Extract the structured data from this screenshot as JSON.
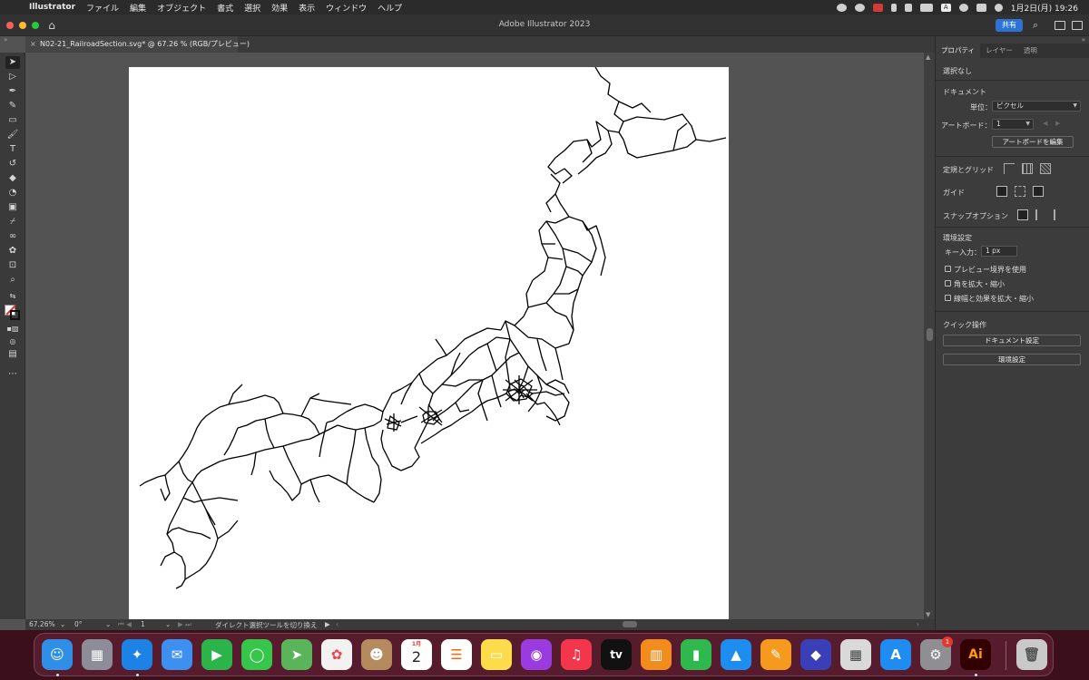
{
  "menubar": {
    "app_name": "Illustrator",
    "menus": [
      "ファイル",
      "編集",
      "オブジェクト",
      "書式",
      "選択",
      "効果",
      "表示",
      "ウィンドウ",
      "ヘルプ"
    ],
    "clock": "1月2日(月)  19:26"
  },
  "titlebar": {
    "title": "Adobe Illustrator 2023",
    "share_label": "共有"
  },
  "document_tab": {
    "label": "N02-21_RailroadSection.svg* @ 67.26 % (RGB/プレビュー)"
  },
  "statusbar": {
    "zoom": "67.26%",
    "rotation": "0°",
    "artboard_number": "1",
    "message": "ダイレクト選択ツールを切り換え"
  },
  "properties_panel": {
    "tabs": [
      "プロパティ",
      "レイヤー",
      "透明"
    ],
    "selection_status": "選択なし",
    "document_header": "ドキュメント",
    "units_label": "単位：",
    "units_value": "ピクセル",
    "artboard_label": "アートボード：",
    "artboard_value": "1",
    "edit_artboards_button": "アートボードを編集",
    "rulers_grid_label": "定規とグリッド",
    "guides_label": "ガイド",
    "snap_label": "スナップオプション",
    "preferences_header": "環境設定",
    "keyboard_increment_label": "キー入力：",
    "keyboard_increment_value": "1 px",
    "checkbox_preview_bounds": "プレビュー境界を使用",
    "checkbox_scale_corners": "角を拡大・縮小",
    "checkbox_scale_strokes": "線幅と効果を拡大・縮小",
    "quick_actions_header": "クイック操作",
    "document_setup_button": "ドキュメント設定",
    "preferences_button": "環境設定"
  },
  "dock": {
    "calendar_month": "1月",
    "calendar_day": "2",
    "tv_label": "tv",
    "ai_label": "Ai",
    "settings_badge": "1"
  }
}
